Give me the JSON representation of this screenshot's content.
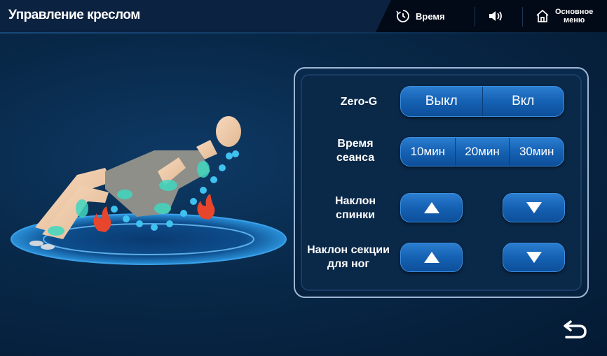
{
  "header": {
    "title": "Управление креслом",
    "time_label": "Время",
    "home_label_line1": "Основное",
    "home_label_line2": "меню"
  },
  "controls": {
    "zero_g": {
      "label": "Zero-G",
      "options": [
        "Выкл",
        "Вкл"
      ]
    },
    "session_time": {
      "label_line1": "Время",
      "label_line2": "сеанса",
      "options": [
        "10мин",
        "20мин",
        "30мин"
      ]
    },
    "backrest": {
      "label_line1": "Наклон",
      "label_line2": "спинки"
    },
    "legrest": {
      "label_line1": "Наклон секции",
      "label_line2": "для ног"
    }
  },
  "icons": {
    "time": "clock-icon",
    "sound": "speaker-icon",
    "home": "home-icon",
    "up": "arrow-up-icon",
    "down": "arrow-down-icon",
    "back": "back-icon"
  },
  "colors": {
    "background": "#082848",
    "button": "#1561b3",
    "massage_points": "#3fc2f0",
    "heat": "#e8462c"
  }
}
